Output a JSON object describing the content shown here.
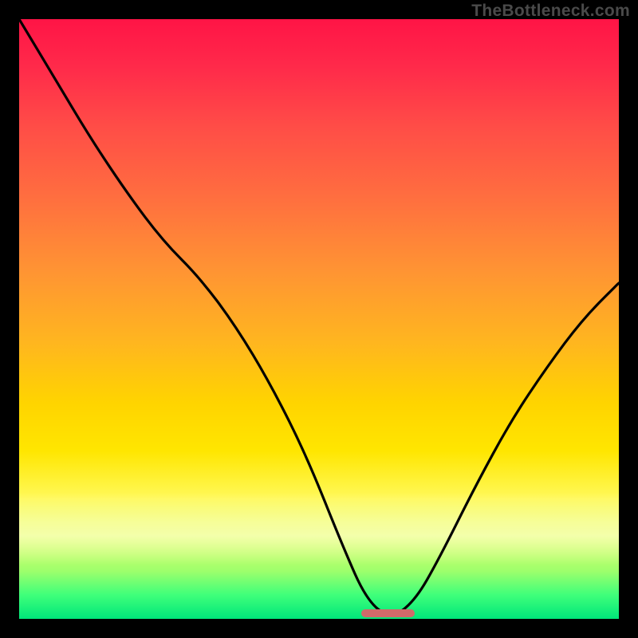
{
  "watermark": "TheBottleneck.com",
  "colors": {
    "frame_bg": "#000000",
    "watermark": "#4a4a4a",
    "curve": "#000000",
    "marker": "#d06a6a"
  },
  "chart_data": {
    "type": "line",
    "title": "",
    "xlabel": "",
    "ylabel": "",
    "xlim": [
      0,
      100
    ],
    "ylim": [
      0,
      100
    ],
    "grid": false,
    "legend": false,
    "note": "Values estimated from pixel positions; no axis labels are shown on the figure.",
    "series": [
      {
        "name": "bottleneck-curve",
        "x": [
          0,
          6,
          12,
          18,
          24,
          30,
          36,
          42,
          48,
          54,
          58,
          62,
          66,
          70,
          76,
          82,
          88,
          94,
          100
        ],
        "y": [
          100,
          90,
          80,
          71,
          63,
          57,
          49,
          39,
          27,
          12,
          3,
          0,
          3,
          10,
          22,
          33,
          42,
          50,
          56
        ]
      }
    ],
    "optimal_marker": {
      "x_start": 57,
      "x_end": 66,
      "y": 0
    }
  }
}
